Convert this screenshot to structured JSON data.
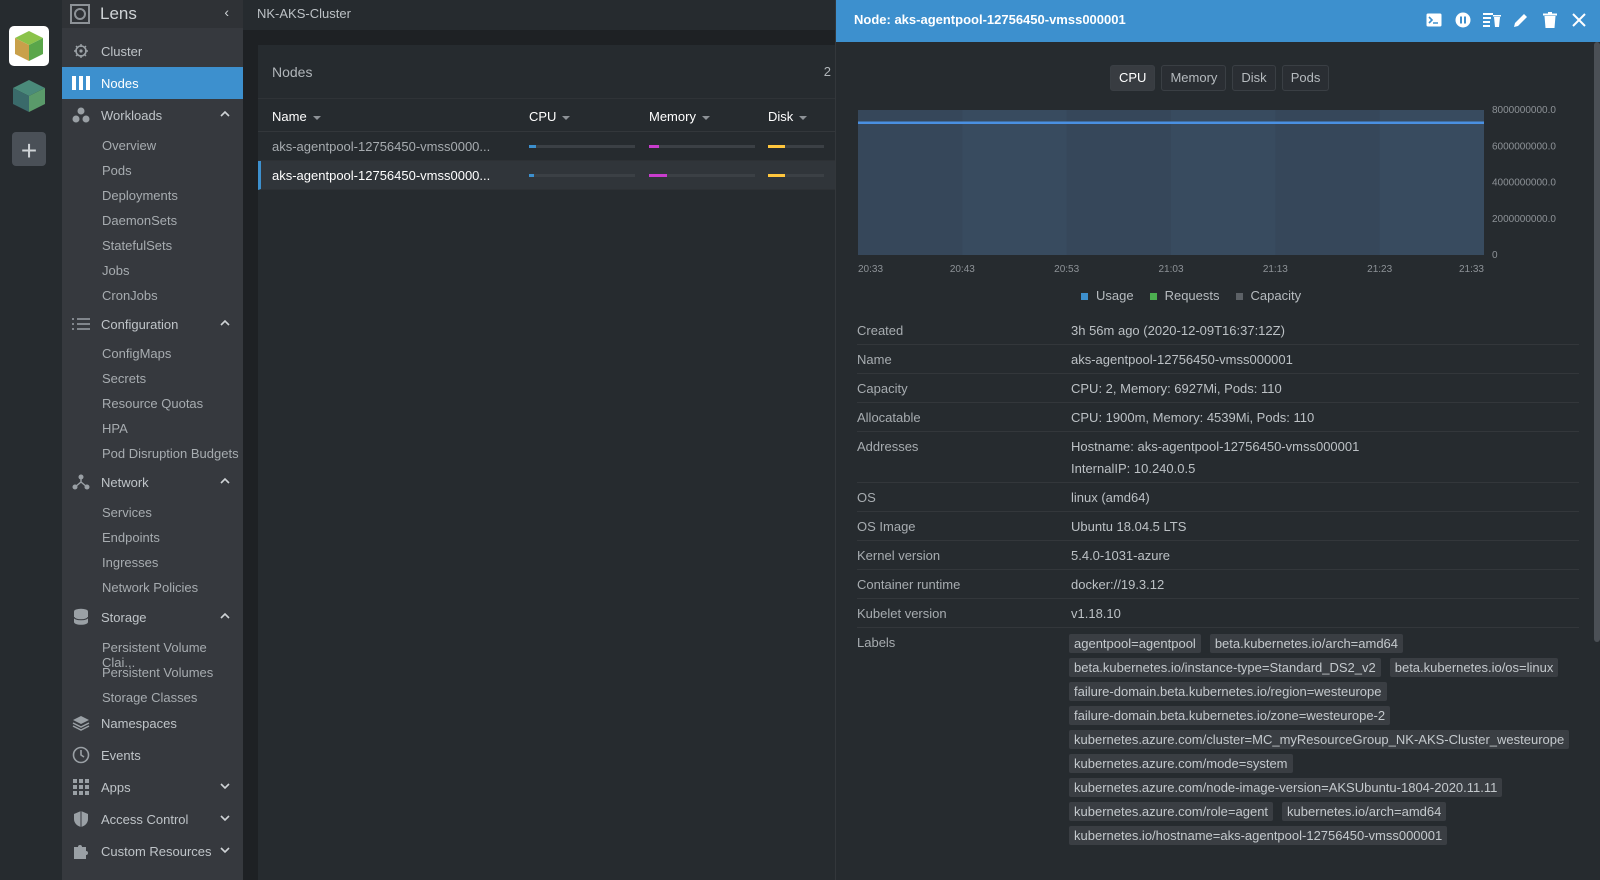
{
  "hotbar": {
    "add_label": "+"
  },
  "sidebar": {
    "app_title": "Lens",
    "items": [
      {
        "label": "Cluster",
        "icon": "helm-wheel-icon"
      },
      {
        "label": "Nodes",
        "icon": "nodes-icon"
      },
      {
        "label": "Workloads",
        "icon": "workloads-icon"
      },
      {
        "label": "Configuration",
        "icon": "list-icon"
      },
      {
        "label": "Network",
        "icon": "network-icon"
      },
      {
        "label": "Storage",
        "icon": "database-icon"
      },
      {
        "label": "Namespaces",
        "icon": "layers-icon"
      },
      {
        "label": "Events",
        "icon": "clock-icon"
      },
      {
        "label": "Apps",
        "icon": "apps-grid-icon"
      },
      {
        "label": "Access Control",
        "icon": "shield-icon"
      },
      {
        "label": "Custom Resources",
        "icon": "puzzle-icon"
      }
    ],
    "workloads": [
      "Overview",
      "Pods",
      "Deployments",
      "DaemonSets",
      "StatefulSets",
      "Jobs",
      "CronJobs"
    ],
    "configuration": [
      "ConfigMaps",
      "Secrets",
      "Resource Quotas",
      "HPA",
      "Pod Disruption Budgets"
    ],
    "network": [
      "Services",
      "Endpoints",
      "Ingresses",
      "Network Policies"
    ],
    "storage": [
      "Persistent Volume Clai...",
      "Persistent Volumes",
      "Storage Classes"
    ]
  },
  "topbar": {
    "cluster": "NK-AKS-Cluster"
  },
  "nodes": {
    "title": "Nodes",
    "count": "2",
    "columns": {
      "name": "Name",
      "cpu": "CPU",
      "memory": "Memory",
      "disk": "Disk"
    },
    "rows": [
      {
        "name": "aks-agentpool-12756450-vmss0000...",
        "cpu": 0.07,
        "memory": 0.09,
        "disk": 0.3
      },
      {
        "name": "aks-agentpool-12756450-vmss0000...",
        "cpu": 0.05,
        "memory": 0.17,
        "disk": 0.3
      }
    ],
    "colors": {
      "cpu": "#3d90ce",
      "memory": "#c93dce",
      "disk": "#ffc63d"
    }
  },
  "drawer": {
    "title": "Node: aks-agentpool-12756450-vmss000001",
    "actions": [
      "terminal-icon",
      "pause-icon",
      "drain-icon",
      "edit-icon",
      "delete-icon",
      "close-icon"
    ],
    "tabs": [
      "CPU",
      "Memory",
      "Disk",
      "Pods"
    ],
    "legend": [
      {
        "label": "Usage",
        "color": "#3d90ce"
      },
      {
        "label": "Requests",
        "color": "#4caf50"
      },
      {
        "label": "Capacity",
        "color": "#5c6166"
      }
    ],
    "properties": [
      {
        "key": "Created",
        "value": "3h 56m ago (2020-12-09T16:37:12Z)"
      },
      {
        "key": "Name",
        "value": "aks-agentpool-12756450-vmss000001"
      },
      {
        "key": "Capacity",
        "value": "CPU: 2, Memory: 6927Mi, Pods: 110"
      },
      {
        "key": "Allocatable",
        "value": "CPU: 1900m, Memory: 4539Mi, Pods: 110"
      },
      {
        "key": "Addresses",
        "value": "Hostname: aks-agentpool-12756450-vmss000001",
        "value2": "InternalIP: 10.240.0.5"
      },
      {
        "key": "OS",
        "value": "linux (amd64)"
      },
      {
        "key": "OS Image",
        "value": "Ubuntu 18.04.5 LTS"
      },
      {
        "key": "Kernel version",
        "value": "5.4.0-1031-azure"
      },
      {
        "key": "Container runtime",
        "value": "docker://19.3.12"
      },
      {
        "key": "Kubelet version",
        "value": "v1.18.10"
      }
    ],
    "labels_key": "Labels",
    "labels": [
      "agentpool=agentpool",
      "beta.kubernetes.io/arch=amd64",
      "beta.kubernetes.io/instance-type=Standard_DS2_v2",
      "beta.kubernetes.io/os=linux",
      "failure-domain.beta.kubernetes.io/region=westeurope",
      "failure-domain.beta.kubernetes.io/zone=westeurope-2",
      "kubernetes.azure.com/cluster=MC_myResourceGroup_NK-AKS-Cluster_westeurope",
      "kubernetes.azure.com/mode=system",
      "kubernetes.azure.com/node-image-version=AKSUbuntu-1804-2020.11.11",
      "kubernetes.azure.com/role=agent",
      "kubernetes.io/arch=amd64",
      "kubernetes.io/hostname=aks-agentpool-12756450-vmss000001"
    ]
  },
  "chart_data": {
    "type": "area",
    "x": [
      "20:33",
      "20:43",
      "20:53",
      "21:03",
      "21:13",
      "21:23",
      "21:33"
    ],
    "yticks": [
      "0",
      "2000000000.0",
      "4000000000.0",
      "6000000000.0",
      "8000000000.0"
    ],
    "ylim": [
      0,
      8000000000
    ],
    "series": [
      {
        "name": "Capacity",
        "values": [
          7300000000,
          7300000000,
          7300000000,
          7300000000,
          7300000000,
          7300000000,
          7300000000
        ]
      }
    ]
  }
}
